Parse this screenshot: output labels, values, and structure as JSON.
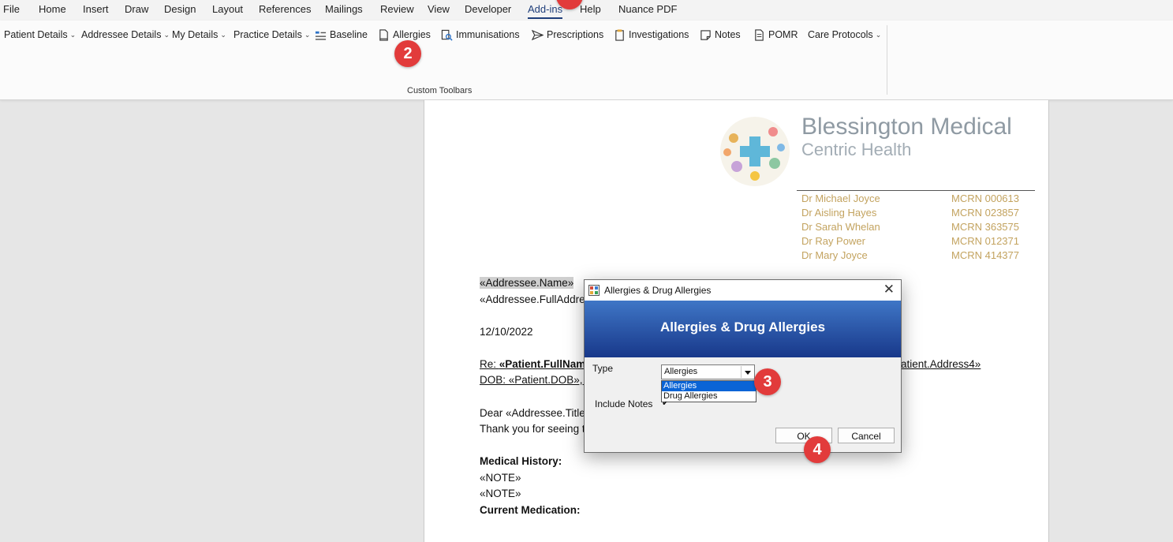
{
  "menu_tabs": [
    "File",
    "Home",
    "Insert",
    "Draw",
    "Design",
    "Layout",
    "References",
    "Mailings",
    "Review",
    "View",
    "Developer",
    "Add-ins",
    "Help",
    "Nuance PDF"
  ],
  "ribbon": {
    "buttons": [
      {
        "label": "Patient Details",
        "icon": "none"
      },
      {
        "label": "Addressee Details",
        "icon": "none"
      },
      {
        "label": "My Details",
        "icon": "none"
      },
      {
        "label": "Practice Details",
        "icon": "none"
      },
      {
        "label": "Baseline",
        "icon": "baseline-icon"
      },
      {
        "label": "Allergies",
        "icon": "document-icon"
      },
      {
        "label": "Immunisations",
        "icon": "syringe-icon"
      },
      {
        "label": "Prescriptions",
        "icon": "paper-plane-icon"
      },
      {
        "label": "Investigations",
        "icon": "clipboard-icon"
      },
      {
        "label": "Notes",
        "icon": "note-icon"
      },
      {
        "label": "POMR",
        "icon": "document-icon"
      },
      {
        "label": "Care Protocols",
        "icon": "none"
      }
    ],
    "group_label": "Custom Toolbars"
  },
  "badges": [
    "2",
    "3",
    "4"
  ],
  "letterhead": {
    "name": "Blessington Medical",
    "subtitle": "Centric Health",
    "doctors": [
      {
        "name": "Dr Michael Joyce",
        "mcrn": "MCRN 000613"
      },
      {
        "name": "Dr Aisling Hayes",
        "mcrn": "MCRN 023857"
      },
      {
        "name": "Dr Sarah Whelan",
        "mcrn": "MCRN 363575"
      },
      {
        "name": "Dr Ray Power",
        "mcrn": "MCRN 012371"
      },
      {
        "name": "Dr Mary Joyce",
        "mcrn": "MCRN 414377"
      }
    ],
    "text_color": "#c3a35f"
  },
  "document": {
    "addressee_name": "«Addressee.Name»",
    "addressee_address": "«Addressee.FullAddre",
    "date": "12/10/2022",
    "re_prefix": "Re: ",
    "re_field": "«Patient.FullName",
    "re_tail": "atient.Address4»",
    "dob_line": "DOB: «Patient.DOB», T",
    "dear_line": "Dear «Addressee.Title",
    "thank_line": "Thank you for seeing t",
    "medical_history_heading": "Medical History:",
    "note1": "«NOTE»",
    "note2": "«NOTE»",
    "current_medication_heading": "Current Medication:"
  },
  "dialog": {
    "title": "Allergies & Drug Allergies",
    "heading": "Allergies & Drug Allergies",
    "type_label": "Type",
    "type_value": "Allergies",
    "type_options": [
      "Allergies",
      "Drug Allergies"
    ],
    "selected_option": "Allergies",
    "include_notes_label": "Include Notes",
    "include_notes_checked": true,
    "ok_label": "OK",
    "cancel_label": "Cancel",
    "close_glyph": "✕",
    "banner_colors": [
      "#3f76c6",
      "#18388a"
    ]
  },
  "colors": {
    "accent_tab": "#1f3e7a",
    "badge": "#e23b3b",
    "selection": "#0a64d6"
  }
}
